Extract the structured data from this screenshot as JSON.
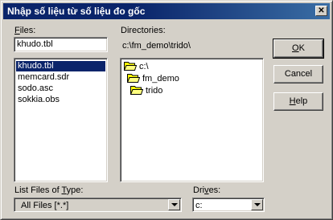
{
  "window": {
    "title": "Nhập số liệu từ số liệu đo gốc",
    "close_label": "✕"
  },
  "files": {
    "label": "Files:",
    "label_underline": "F",
    "label_rest": "iles:",
    "input_value": "khudo.tbl",
    "items": [
      "khudo.tbl",
      "memcard.sdr",
      "sodo.asc",
      "sokkia.obs"
    ],
    "selected_index": 0
  },
  "directories": {
    "label": "Directories:",
    "current_path": "c:\\fm_demo\\trido\\",
    "tree": [
      {
        "label": "c:\\",
        "level": 0,
        "icon": "open-folder-icon"
      },
      {
        "label": "fm_demo",
        "level": 1,
        "icon": "open-folder-icon"
      },
      {
        "label": "trido",
        "level": 2,
        "icon": "open-folder-icon"
      }
    ]
  },
  "buttons": {
    "ok": {
      "label": "OK",
      "u": "O",
      "rest": "K"
    },
    "cancel": {
      "label": "Cancel"
    },
    "help": {
      "label": "Help",
      "u": "H",
      "rest": "elp"
    }
  },
  "file_type": {
    "label": "List Files of Type:",
    "label_pre": "List Files of ",
    "label_u": "T",
    "label_post": "ype:",
    "selected": "All Files [*.*]"
  },
  "drives": {
    "label": "Drives:",
    "label_pre": "Dri",
    "label_u": "v",
    "label_post": "es:",
    "selected": "c:"
  },
  "colors": {
    "titlebar": "#0a246a",
    "face": "#d4d0c8",
    "selection": "#0a246a",
    "folder": "#ffff00"
  }
}
